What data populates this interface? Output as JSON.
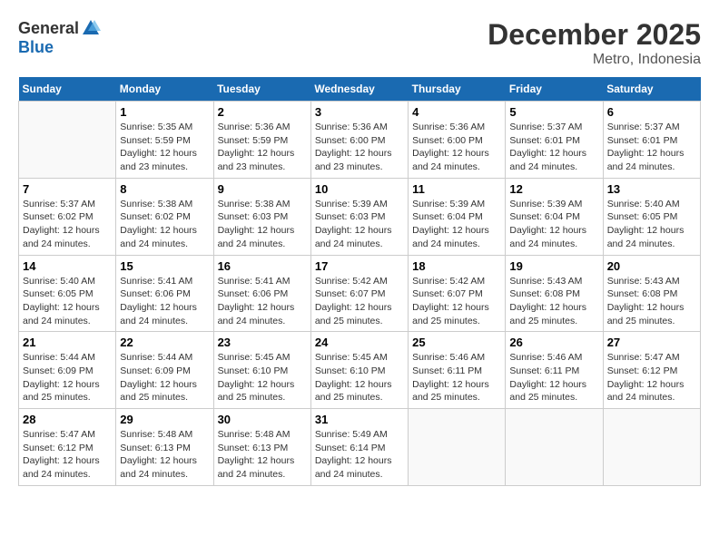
{
  "header": {
    "logo_general": "General",
    "logo_blue": "Blue",
    "title": "December 2025",
    "subtitle": "Metro, Indonesia"
  },
  "days_of_week": [
    "Sunday",
    "Monday",
    "Tuesday",
    "Wednesday",
    "Thursday",
    "Friday",
    "Saturday"
  ],
  "weeks": [
    [
      {
        "day": "",
        "detail": ""
      },
      {
        "day": "1",
        "detail": "Sunrise: 5:35 AM\nSunset: 5:59 PM\nDaylight: 12 hours\nand 23 minutes."
      },
      {
        "day": "2",
        "detail": "Sunrise: 5:36 AM\nSunset: 5:59 PM\nDaylight: 12 hours\nand 23 minutes."
      },
      {
        "day": "3",
        "detail": "Sunrise: 5:36 AM\nSunset: 6:00 PM\nDaylight: 12 hours\nand 23 minutes."
      },
      {
        "day": "4",
        "detail": "Sunrise: 5:36 AM\nSunset: 6:00 PM\nDaylight: 12 hours\nand 24 minutes."
      },
      {
        "day": "5",
        "detail": "Sunrise: 5:37 AM\nSunset: 6:01 PM\nDaylight: 12 hours\nand 24 minutes."
      },
      {
        "day": "6",
        "detail": "Sunrise: 5:37 AM\nSunset: 6:01 PM\nDaylight: 12 hours\nand 24 minutes."
      }
    ],
    [
      {
        "day": "7",
        "detail": "Sunrise: 5:37 AM\nSunset: 6:02 PM\nDaylight: 12 hours\nand 24 minutes."
      },
      {
        "day": "8",
        "detail": "Sunrise: 5:38 AM\nSunset: 6:02 PM\nDaylight: 12 hours\nand 24 minutes."
      },
      {
        "day": "9",
        "detail": "Sunrise: 5:38 AM\nSunset: 6:03 PM\nDaylight: 12 hours\nand 24 minutes."
      },
      {
        "day": "10",
        "detail": "Sunrise: 5:39 AM\nSunset: 6:03 PM\nDaylight: 12 hours\nand 24 minutes."
      },
      {
        "day": "11",
        "detail": "Sunrise: 5:39 AM\nSunset: 6:04 PM\nDaylight: 12 hours\nand 24 minutes."
      },
      {
        "day": "12",
        "detail": "Sunrise: 5:39 AM\nSunset: 6:04 PM\nDaylight: 12 hours\nand 24 minutes."
      },
      {
        "day": "13",
        "detail": "Sunrise: 5:40 AM\nSunset: 6:05 PM\nDaylight: 12 hours\nand 24 minutes."
      }
    ],
    [
      {
        "day": "14",
        "detail": "Sunrise: 5:40 AM\nSunset: 6:05 PM\nDaylight: 12 hours\nand 24 minutes."
      },
      {
        "day": "15",
        "detail": "Sunrise: 5:41 AM\nSunset: 6:06 PM\nDaylight: 12 hours\nand 24 minutes."
      },
      {
        "day": "16",
        "detail": "Sunrise: 5:41 AM\nSunset: 6:06 PM\nDaylight: 12 hours\nand 24 minutes."
      },
      {
        "day": "17",
        "detail": "Sunrise: 5:42 AM\nSunset: 6:07 PM\nDaylight: 12 hours\nand 25 minutes."
      },
      {
        "day": "18",
        "detail": "Sunrise: 5:42 AM\nSunset: 6:07 PM\nDaylight: 12 hours\nand 25 minutes."
      },
      {
        "day": "19",
        "detail": "Sunrise: 5:43 AM\nSunset: 6:08 PM\nDaylight: 12 hours\nand 25 minutes."
      },
      {
        "day": "20",
        "detail": "Sunrise: 5:43 AM\nSunset: 6:08 PM\nDaylight: 12 hours\nand 25 minutes."
      }
    ],
    [
      {
        "day": "21",
        "detail": "Sunrise: 5:44 AM\nSunset: 6:09 PM\nDaylight: 12 hours\nand 25 minutes."
      },
      {
        "day": "22",
        "detail": "Sunrise: 5:44 AM\nSunset: 6:09 PM\nDaylight: 12 hours\nand 25 minutes."
      },
      {
        "day": "23",
        "detail": "Sunrise: 5:45 AM\nSunset: 6:10 PM\nDaylight: 12 hours\nand 25 minutes."
      },
      {
        "day": "24",
        "detail": "Sunrise: 5:45 AM\nSunset: 6:10 PM\nDaylight: 12 hours\nand 25 minutes."
      },
      {
        "day": "25",
        "detail": "Sunrise: 5:46 AM\nSunset: 6:11 PM\nDaylight: 12 hours\nand 25 minutes."
      },
      {
        "day": "26",
        "detail": "Sunrise: 5:46 AM\nSunset: 6:11 PM\nDaylight: 12 hours\nand 25 minutes."
      },
      {
        "day": "27",
        "detail": "Sunrise: 5:47 AM\nSunset: 6:12 PM\nDaylight: 12 hours\nand 24 minutes."
      }
    ],
    [
      {
        "day": "28",
        "detail": "Sunrise: 5:47 AM\nSunset: 6:12 PM\nDaylight: 12 hours\nand 24 minutes."
      },
      {
        "day": "29",
        "detail": "Sunrise: 5:48 AM\nSunset: 6:13 PM\nDaylight: 12 hours\nand 24 minutes."
      },
      {
        "day": "30",
        "detail": "Sunrise: 5:48 AM\nSunset: 6:13 PM\nDaylight: 12 hours\nand 24 minutes."
      },
      {
        "day": "31",
        "detail": "Sunrise: 5:49 AM\nSunset: 6:14 PM\nDaylight: 12 hours\nand 24 minutes."
      },
      {
        "day": "",
        "detail": ""
      },
      {
        "day": "",
        "detail": ""
      },
      {
        "day": "",
        "detail": ""
      }
    ]
  ]
}
